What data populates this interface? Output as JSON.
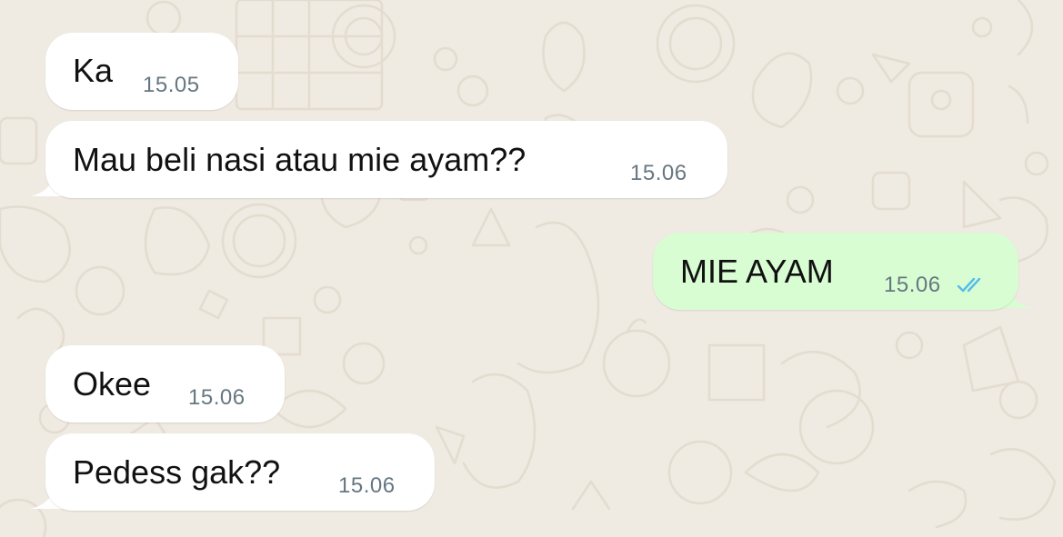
{
  "messages": [
    {
      "text": "Ka",
      "time": "15.05",
      "direction": "incoming"
    },
    {
      "text": "Mau beli nasi atau mie ayam??",
      "time": "15.06",
      "direction": "incoming"
    },
    {
      "text": "MIE AYAM",
      "time": "15.06",
      "direction": "outgoing",
      "status_icon": "double-check-read-icon"
    },
    {
      "text": "Okee",
      "time": "15.06",
      "direction": "incoming"
    },
    {
      "text": "Pedess gak??",
      "time": "15.06",
      "direction": "incoming"
    }
  ],
  "colors": {
    "wallpaper": "#efeae2",
    "incoming_bubble": "#ffffff",
    "outgoing_bubble": "#d9fdd3",
    "timestamp": "#667781",
    "read_ticks": "#53bdeb"
  }
}
